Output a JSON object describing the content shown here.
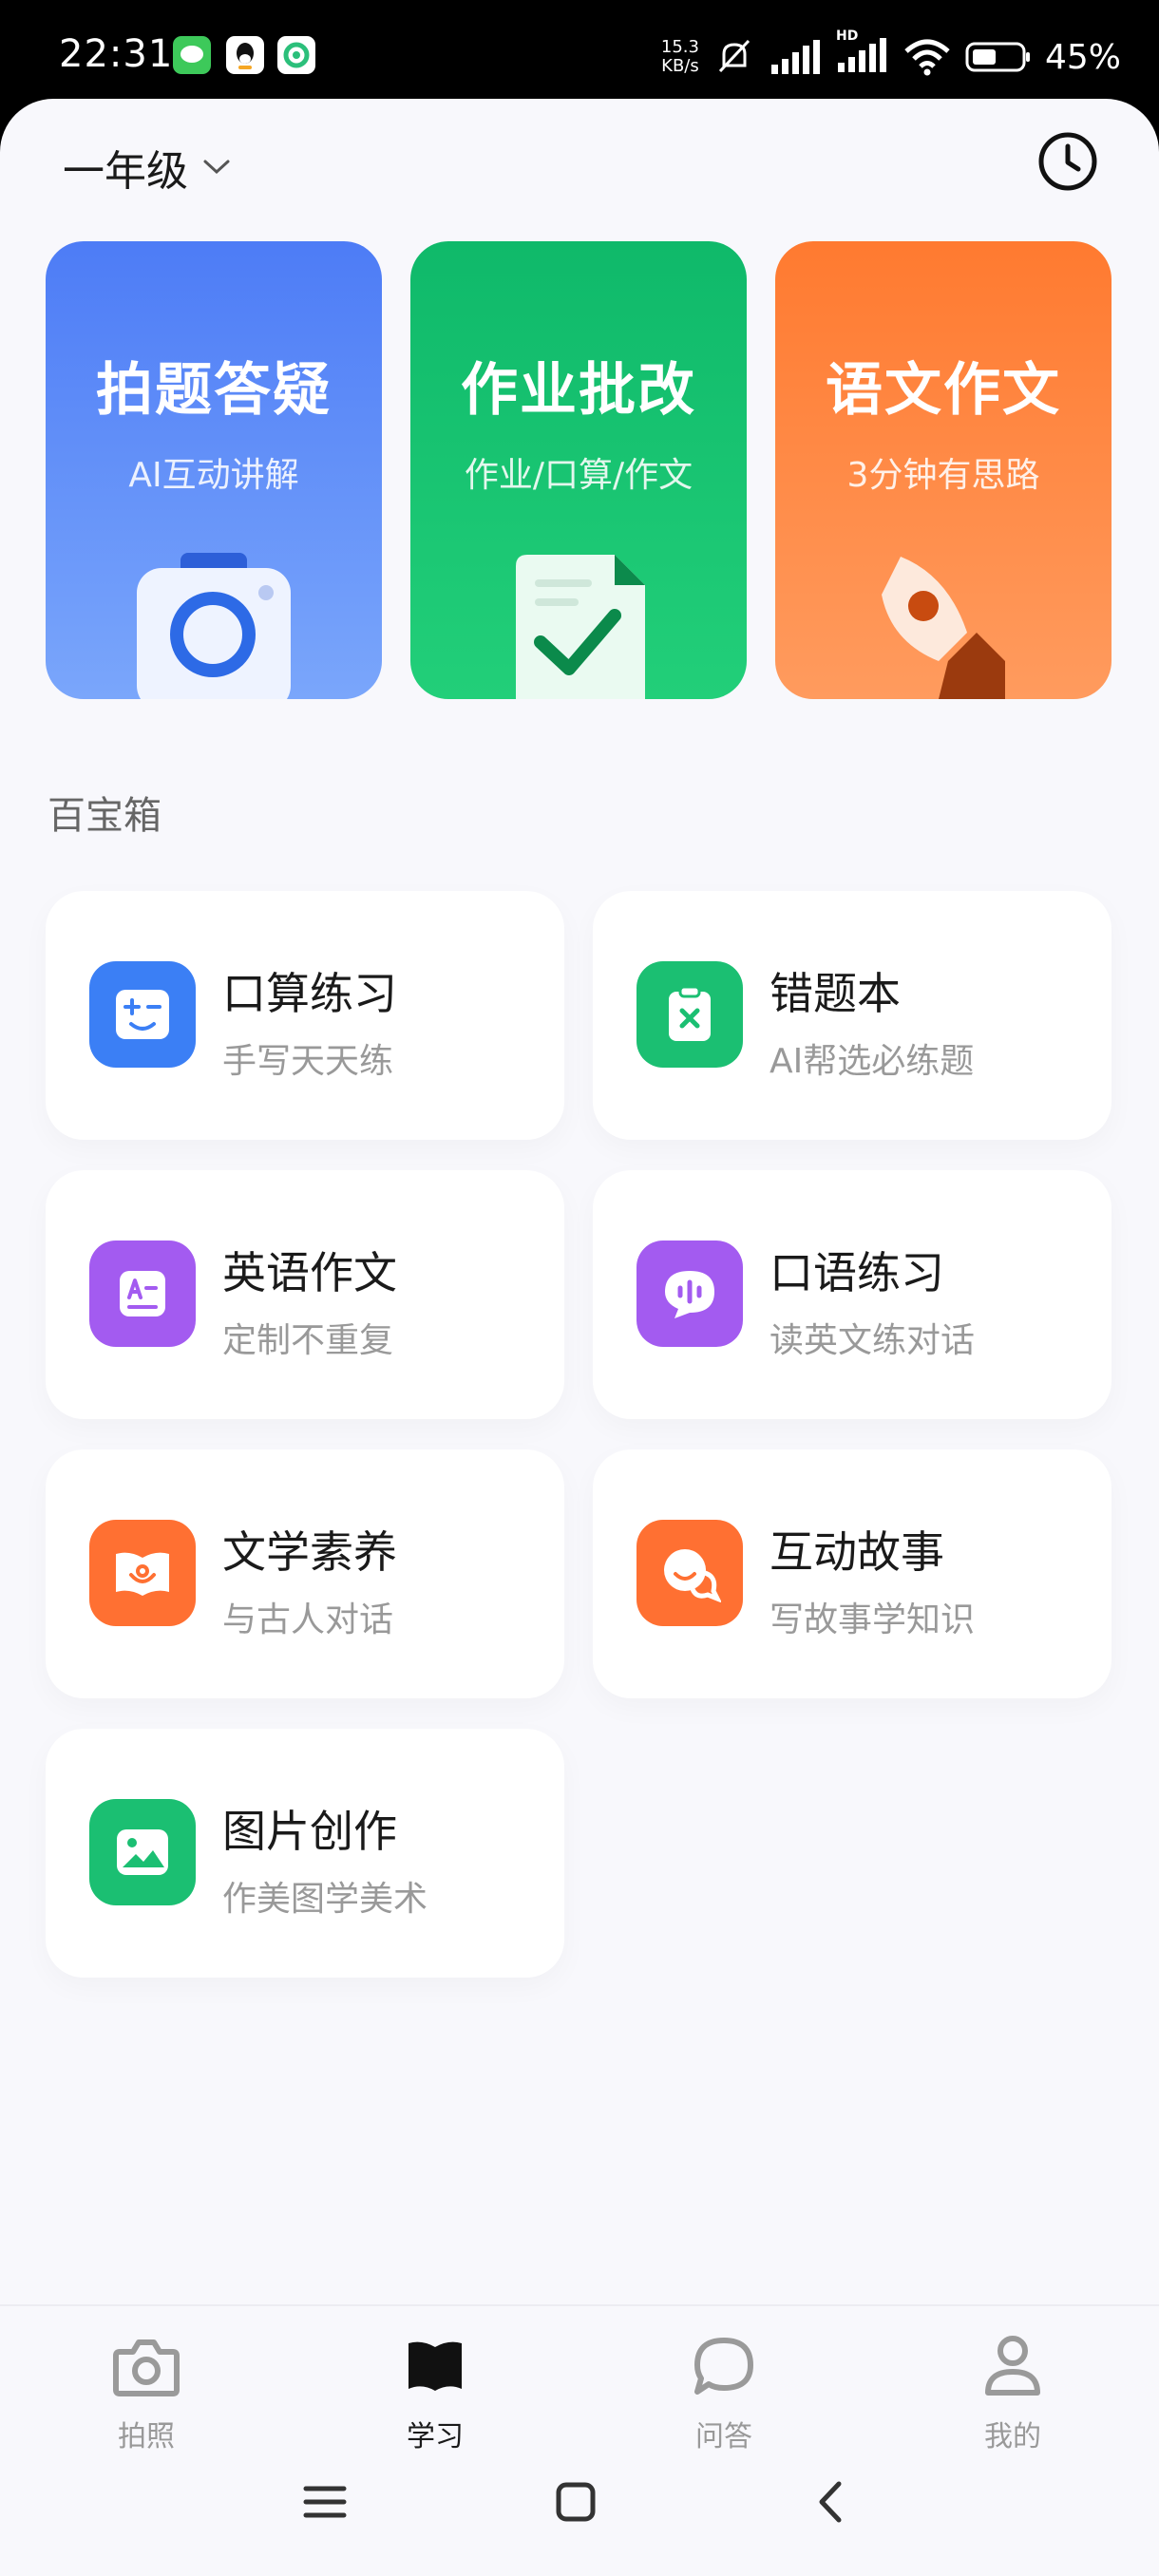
{
  "status_bar": {
    "time": "22:31",
    "net_speed_value": "15.3",
    "net_speed_unit": "KB/s",
    "battery": "45%",
    "signal_label": "HD"
  },
  "header": {
    "grade": "一年级"
  },
  "feature_cards": [
    {
      "title": "拍题答疑",
      "subtitle": "AI互动讲解",
      "color": "#5b86f7",
      "icon": "camera-icon"
    },
    {
      "title": "作业批改",
      "subtitle": "作业/口算/作文",
      "color": "#17c36c",
      "icon": "document-check-icon"
    },
    {
      "title": "语文作文",
      "subtitle": "3分钟有思路",
      "color": "#ff7f3a",
      "icon": "pen-nib-icon"
    }
  ],
  "toolbox": {
    "title": "百宝箱",
    "items": [
      {
        "title": "口算练习",
        "subtitle": "手写天天练",
        "color": "#3b7ff5",
        "icon": "math-face-icon"
      },
      {
        "title": "错题本",
        "subtitle": "AI帮选必练题",
        "color": "#1bbf72",
        "icon": "clipboard-x-icon"
      },
      {
        "title": "英语作文",
        "subtitle": "定制不重复",
        "color": "#a35bf0",
        "icon": "letter-a-doc-icon"
      },
      {
        "title": "口语练习",
        "subtitle": "读英文练对话",
        "color": "#a35bf0",
        "icon": "speech-wave-icon"
      },
      {
        "title": "文学素养",
        "subtitle": "与古人对话",
        "color": "#ff7032",
        "icon": "open-book-icon"
      },
      {
        "title": "互动故事",
        "subtitle": "写故事学知识",
        "color": "#ff7032",
        "icon": "chat-smile-icon"
      },
      {
        "title": "图片创作",
        "subtitle": "作美图学美术",
        "color": "#1bbf72",
        "icon": "image-icon"
      }
    ]
  },
  "bottom_nav": [
    {
      "label": "拍照",
      "icon": "camera-outline-icon",
      "active": false
    },
    {
      "label": "学习",
      "icon": "book-icon",
      "active": true
    },
    {
      "label": "问答",
      "icon": "chat-bubble-icon",
      "active": false
    },
    {
      "label": "我的",
      "icon": "person-icon",
      "active": false
    }
  ]
}
